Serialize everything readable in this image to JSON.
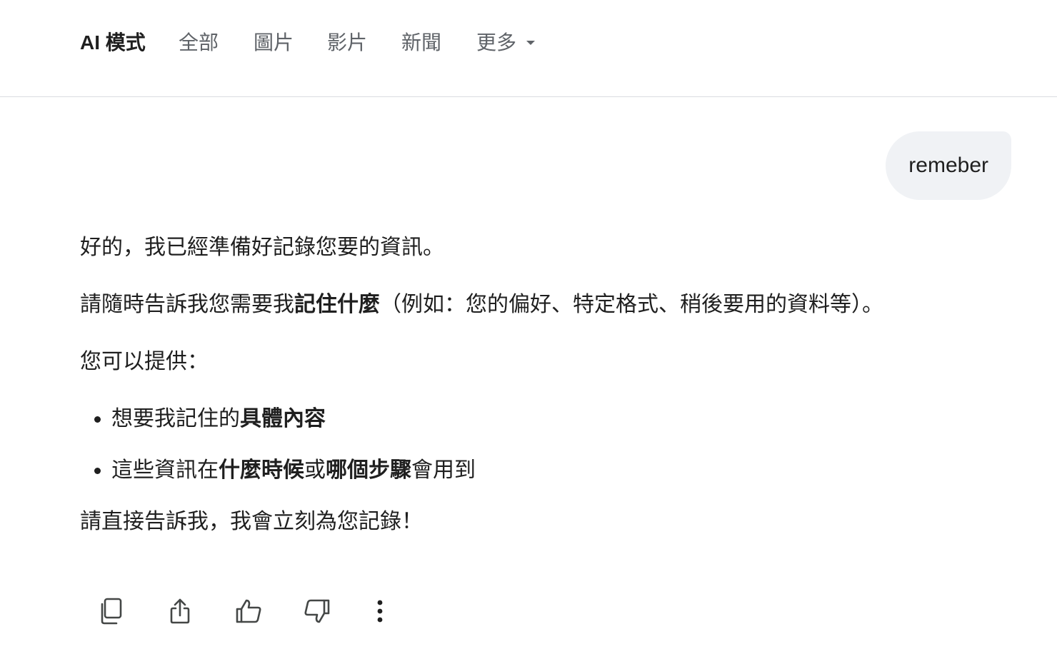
{
  "tabs": [
    {
      "label": "AI 模式",
      "active": true
    },
    {
      "label": "全部",
      "active": false
    },
    {
      "label": "圖片",
      "active": false
    },
    {
      "label": "影片",
      "active": false
    },
    {
      "label": "新聞",
      "active": false
    },
    {
      "label": "更多",
      "active": false,
      "dropdown": true
    }
  ],
  "query": {
    "text": "remeber"
  },
  "response": {
    "p1": "好的，我已經準備好記錄您要的資訊。",
    "p2": {
      "pre": "請隨時告訴我您需要我",
      "bold": "記住什麼",
      "post": "（例如：您的偏好、特定格式、稍後要用的資料等）。"
    },
    "p3": "您可以提供：",
    "bullet1": {
      "pre": "想要我記住的",
      "bold": "具體內容"
    },
    "bullet2": {
      "pre": "這些資訊在",
      "bold1": "什麼時候",
      "mid": "或",
      "bold2": "哪個步驟",
      "post": "會用到"
    },
    "p4": "請直接告訴我，我會立刻為您記錄！"
  },
  "actions": {
    "icons": [
      "copy-icon",
      "share-icon",
      "thumbs-up-icon",
      "thumbs-down-icon",
      "more-vert-icon"
    ]
  },
  "colors": {
    "text": "#1f1f1f",
    "tab_inactive": "#5f6368",
    "bubble_bg": "#f0f2f5",
    "divider": "#dadce0"
  }
}
